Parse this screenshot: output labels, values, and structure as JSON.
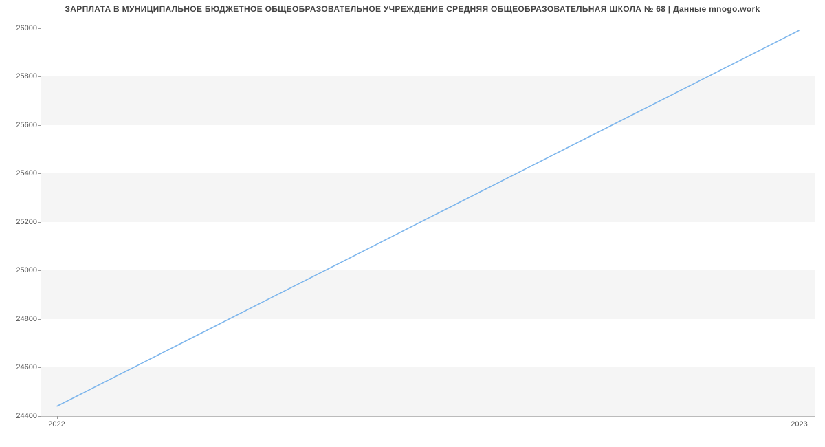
{
  "chart_data": {
    "type": "line",
    "title": "ЗАРПЛАТА В МУНИЦИПАЛЬНОЕ БЮДЖЕТНОЕ ОБЩЕОБРАЗОВАТЕЛЬНОЕ УЧРЕЖДЕНИЕ СРЕДНЯЯ ОБЩЕОБРАЗОВАТЕЛЬНАЯ ШКОЛА № 68 | Данные mnogo.work",
    "xlabel": "",
    "ylabel": "",
    "x": [
      "2022",
      "2023"
    ],
    "values": [
      24440,
      25990
    ],
    "y_ticks": [
      24400,
      24600,
      24800,
      25000,
      25200,
      25400,
      25600,
      25800,
      26000
    ],
    "x_ticks": [
      "2022",
      "2023"
    ],
    "ylim": [
      24400,
      26030
    ],
    "line_color": "#7cb5ec"
  }
}
